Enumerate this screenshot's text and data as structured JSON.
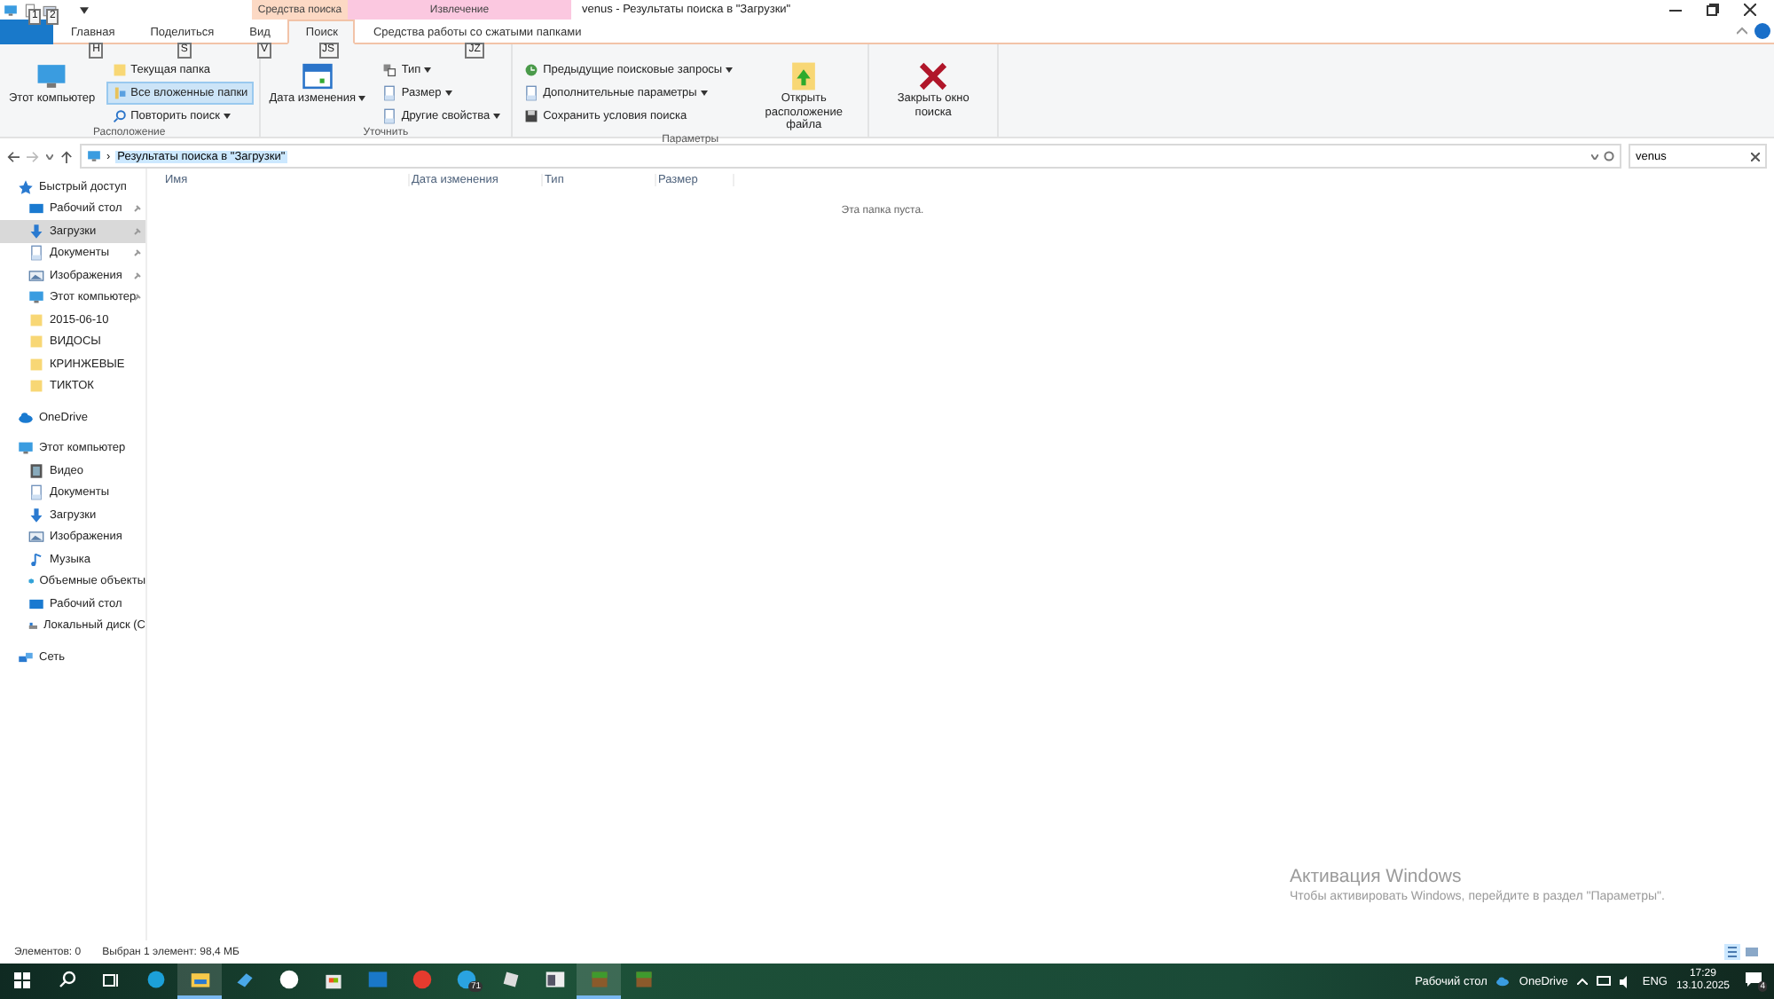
{
  "quick_access": {
    "keytips": [
      "1",
      "2"
    ]
  },
  "context_headers": [
    {
      "label": "Средства поиска",
      "color": "#fcd9c4"
    },
    {
      "label": "Извлечение",
      "color": "#fbc8e0"
    }
  ],
  "window": {
    "title": "venus - Результаты поиска в \"Загрузки\""
  },
  "tabs": [
    {
      "kind": "file",
      "selected": false
    },
    {
      "kind": "plain",
      "label": "Главная",
      "keytip": "H",
      "selected": false
    },
    {
      "kind": "plain",
      "label": "Поделиться",
      "keytip": "S",
      "selected": false
    },
    {
      "kind": "plain",
      "label": "Вид",
      "keytip": "V",
      "selected": false
    },
    {
      "kind": "plain",
      "label": "Поиск",
      "keytip": "JS",
      "selected": true
    },
    {
      "kind": "plain",
      "label": "Средства работы со сжатыми папками",
      "keytip": "JZ",
      "selected": false
    }
  ],
  "ribbon": [
    {
      "label": "Расположение",
      "columns": [
        [
          {
            "kind": "large",
            "label": "Этот компьютер",
            "selected": false
          }
        ],
        [
          {
            "kind": "small",
            "label": "Текущая папка",
            "dropdown": false,
            "selected": false
          },
          {
            "kind": "small",
            "label": "Все вложенные папки",
            "dropdown": false,
            "selected": true
          },
          {
            "kind": "small",
            "label": "Повторить поиск",
            "dropdown": true,
            "selected": false
          }
        ]
      ]
    },
    {
      "label": "Уточнить",
      "columns": [
        [
          {
            "kind": "large",
            "label": "Дата изменения",
            "dropdown": true,
            "selected": false
          }
        ],
        [
          {
            "kind": "small",
            "label": "Тип",
            "dropdown": true,
            "selected": false
          },
          {
            "kind": "small",
            "label": "Размер",
            "dropdown": true,
            "selected": false
          },
          {
            "kind": "small",
            "label": "Другие свойства",
            "dropdown": true,
            "selected": false
          }
        ]
      ]
    },
    {
      "label": "Параметры",
      "columns": [
        [
          {
            "kind": "small",
            "label": "Предыдущие поисковые запросы",
            "dropdown": true,
            "selected": false
          },
          {
            "kind": "small",
            "label": "Дополнительные параметры",
            "dropdown": true,
            "selected": false
          },
          {
            "kind": "small",
            "label": "Сохранить условия поиска",
            "dropdown": false,
            "selected": false
          }
        ],
        [
          {
            "kind": "large",
            "label": "Открыть расположение файла",
            "dropdown": false,
            "selected": false
          }
        ]
      ]
    },
    {
      "columns": [
        [
          {
            "kind": "large",
            "label": "Закрыть окно поиска",
            "dropdown": false,
            "selected": false
          }
        ]
      ]
    }
  ],
  "address": {
    "separator": "›",
    "path": "Результаты поиска в \"Загрузки\"",
    "search": "venus"
  },
  "columns": [
    "Имя",
    "Дата изменения",
    "Тип",
    "Размер"
  ],
  "empty_message": "Эта папка пуста.",
  "sidebar": [
    {
      "label": "Быстрый доступ",
      "selected": false,
      "children": [
        {
          "label": "Рабочий стол",
          "pinned": true,
          "selected": false
        },
        {
          "label": "Загрузки",
          "pinned": true,
          "selected": true
        },
        {
          "label": "Документы",
          "pinned": true,
          "selected": false
        },
        {
          "label": "Изображения",
          "pinned": true,
          "selected": false
        },
        {
          "label": "Этот компьютер",
          "pinned": true,
          "selected": false
        },
        {
          "label": "2015-06-10",
          "pinned": false,
          "selected": false
        },
        {
          "label": "ВИДОСЫ",
          "pinned": false,
          "selected": false
        },
        {
          "label": "КРИНЖЕВЫЕ",
          "pinned": false,
          "selected": false
        },
        {
          "label": "ТИКТОК",
          "pinned": false,
          "selected": false
        }
      ]
    },
    {
      "label": "OneDrive",
      "selected": false
    },
    {
      "label": "Этот компьютер",
      "selected": false,
      "children": [
        {
          "label": "Видео",
          "pinned": false,
          "selected": false
        },
        {
          "label": "Документы",
          "pinned": false,
          "selected": false
        },
        {
          "label": "Загрузки",
          "pinned": false,
          "selected": false
        },
        {
          "label": "Изображения",
          "pinned": false,
          "selected": false
        },
        {
          "label": "Музыка",
          "pinned": false,
          "selected": false
        },
        {
          "label": "Объемные объекты",
          "pinned": false,
          "selected": false
        },
        {
          "label": "Рабочий стол",
          "pinned": false,
          "selected": false
        },
        {
          "label": "Локальный диск (C",
          "pinned": false,
          "selected": false
        }
      ]
    },
    {
      "label": "Сеть",
      "selected": false
    }
  ],
  "activation": {
    "title": "Активация Windows",
    "text": "Чтобы активировать Windows, перейдите в раздел \"Параметры\"."
  },
  "status_bar": {
    "count": "Элементов: 0",
    "selection": "Выбран 1 элемент: 98,4 МБ"
  },
  "taskbar": {
    "apps": [
      {
        "active": false
      },
      {
        "active": true
      },
      {
        "active": false
      },
      {
        "active": false
      },
      {
        "active": false
      },
      {
        "active": false
      },
      {
        "active": false
      },
      {
        "active": false,
        "badge": "71"
      },
      {
        "active": false
      },
      {
        "active": false
      },
      {
        "active": true
      },
      {
        "active": false
      }
    ],
    "desktop_label": "Рабочий стол",
    "onedrive": "OneDrive",
    "language": "ENG",
    "time": "17:29",
    "date": "13.10.2025",
    "notifications": "4"
  }
}
